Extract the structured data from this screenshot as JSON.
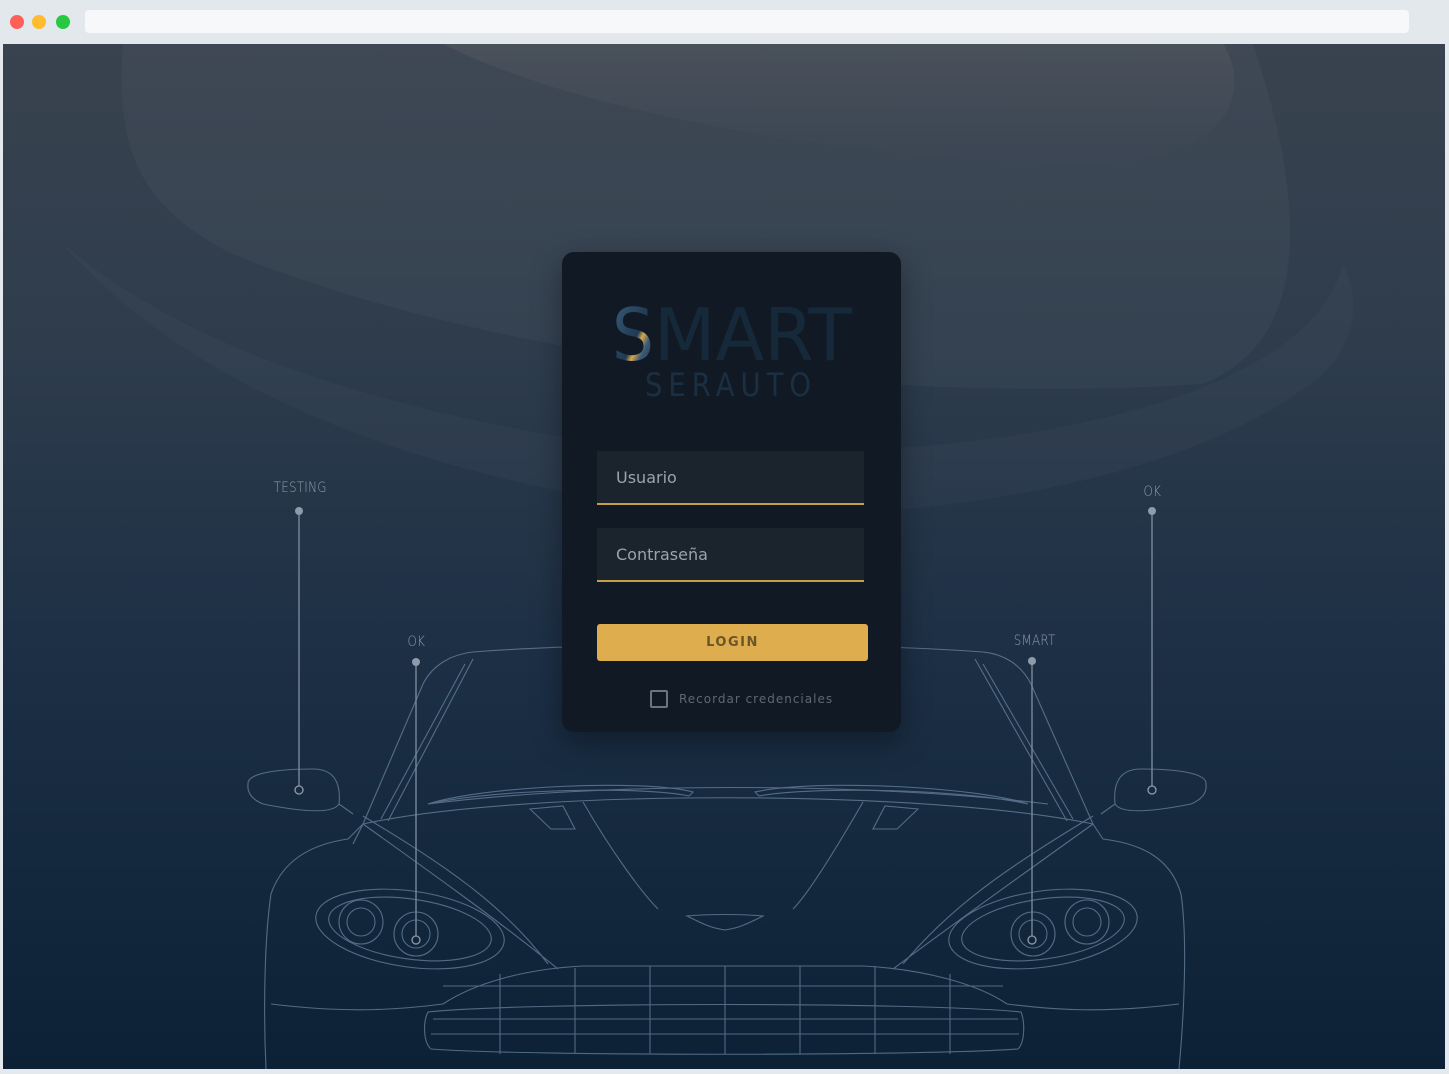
{
  "colors": {
    "accent": "#ddad4e",
    "card": "#111a24",
    "field": "#1b232d",
    "logo_text": "#16293a",
    "line_art": "#6f8aa6"
  },
  "logo": {
    "top": "SMART",
    "bottom": "SERAUTO"
  },
  "form": {
    "username_placeholder": "Usuario",
    "password_placeholder": "Contraseña",
    "login_label": "LOGIN",
    "remember_label": "Recordar credenciales"
  },
  "callouts": {
    "left_mirror": "TESTING",
    "left_headlight": "OK",
    "right_headlight": "SMART",
    "right_mirror": "OK"
  }
}
